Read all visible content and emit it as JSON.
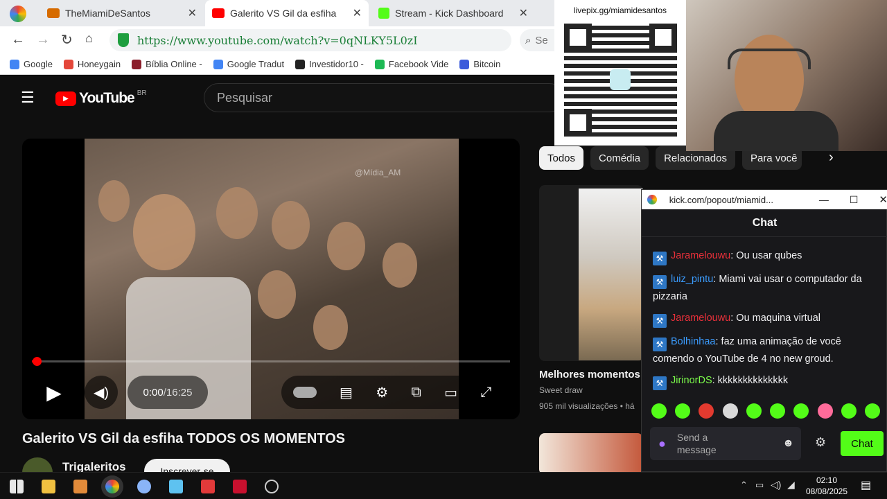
{
  "browser": {
    "tabs": [
      {
        "label": "TheMiamiDeSantos",
        "icon_color": "#d66b00"
      },
      {
        "label": "Galerito VS Gil da esfiha",
        "icon_color": "#ff0000"
      },
      {
        "label": "Stream - Kick Dashboard",
        "icon_color": "#53fc18"
      }
    ],
    "url": "https://www.youtube.com/watch?v=0qNLKY5L0zI",
    "search_partial": "Se",
    "bookmarks": [
      "Google",
      "Honeygain",
      "Bíblia Online -",
      "Google Tradut",
      "Investidor10 -",
      "Facebook Vide",
      "Bitcoin"
    ]
  },
  "youtube": {
    "logo": "YouTube",
    "region": "BR",
    "search_placeholder": "Pesquisar",
    "watermark": "@Mídia_AM",
    "time_current": "0:00",
    "time_sep": " / ",
    "time_total": "16:25",
    "progress": 0.01,
    "video_title": "Galerito VS Gil da esfiha TODOS OS MOMENTOS",
    "channel": "Trigaleritos",
    "subscribe_label": "Inscrever-se",
    "chips": [
      "Todos",
      "Comédia",
      "Relacionados",
      "Para você"
    ],
    "recommended": {
      "title": "Melhores momentos",
      "channel": "Sweet draw",
      "meta": "905 mil visualizações • há"
    }
  },
  "overlay": {
    "livepix": "livepix.gg/miamidesantos"
  },
  "chat": {
    "window_url": "kick.com/popout/miamid...",
    "title": "Chat",
    "messages": [
      {
        "user": "Jaramelouwu",
        "color": "#e8303a",
        "text": ": Ou usar qubes"
      },
      {
        "user": "luiz_pintu",
        "color": "#3b9cff",
        "text": ": Miami vai usar o computador da pizzaria"
      },
      {
        "user": "Jaramelouwu",
        "color": "#e8303a",
        "text": ": Ou maquina virtual"
      },
      {
        "user": "Bolhinhaa",
        "color": "#3b9cff",
        "text": ": faz uma animação de você comendo o YouTube de 4 no new groud."
      },
      {
        "user": "JirinorDS",
        "color": "#7cfc4b",
        "text": ": kkkkkkkkkkkkkk"
      }
    ],
    "input_placeholder": "Send a message",
    "send_label": "Chat",
    "accent": "#53fc18"
  },
  "taskbar": {
    "time": "02:10",
    "date": "08/08/2025"
  }
}
